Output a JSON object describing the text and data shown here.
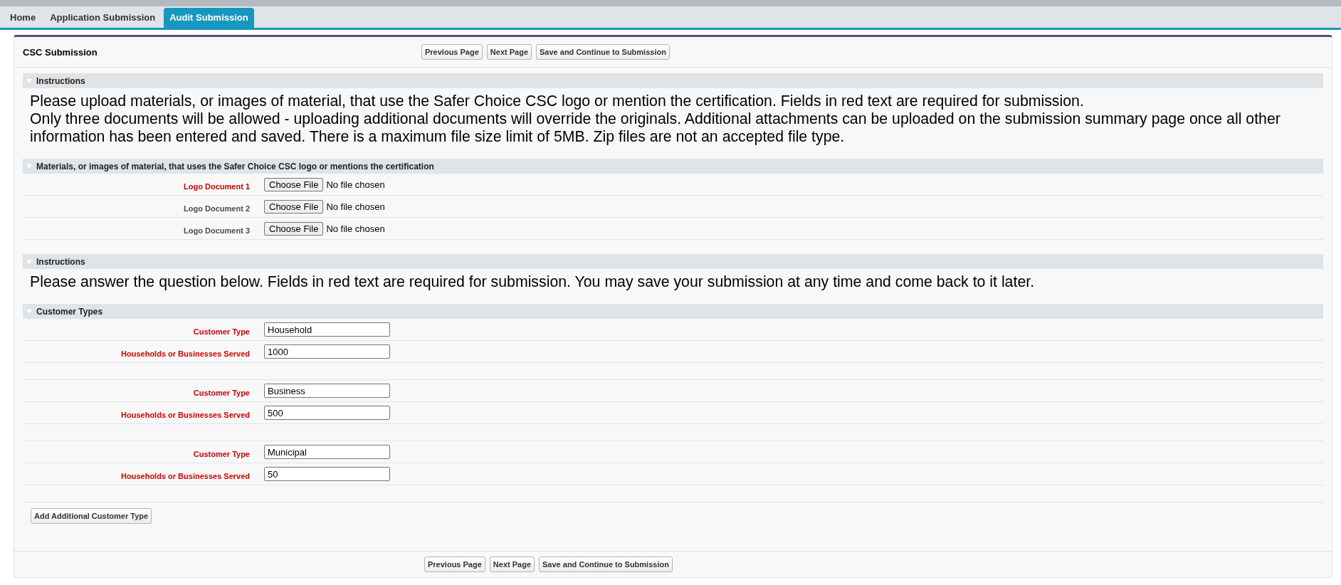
{
  "tabs": [
    {
      "label": "Home",
      "selected": false
    },
    {
      "label": "Application Submission",
      "selected": false
    },
    {
      "label": "Audit Submission",
      "selected": true
    }
  ],
  "header": {
    "title": "CSC Submission",
    "buttons": [
      "Previous Page",
      "Next Page",
      "Save and Continue to Submission"
    ]
  },
  "sections": [
    {
      "kind": "text",
      "title": "Instructions",
      "paragraphs": [
        "Please upload materials, or images of material, that use the Safer Choice CSC logo or mention the certification. Fields in red text are required for submission.",
        "Only three documents will be allowed - uploading additional documents will override the originals. Additional attachments can be uploaded on the submission summary page once all other information has been entered and saved. There is a maximum file size limit of 5MB. Zip files are not an accepted file type."
      ]
    },
    {
      "kind": "files",
      "title": "Materials, or images of material, that uses the Safer Choice CSC logo or mentions the certification",
      "fields": [
        {
          "label": "Logo Document 1",
          "required": true,
          "button": "Choose File",
          "status": "No file chosen"
        },
        {
          "label": "Logo Document 2",
          "required": false,
          "button": "Choose File",
          "status": "No file chosen"
        },
        {
          "label": "Logo Document 3",
          "required": false,
          "button": "Choose File",
          "status": "No file chosen"
        }
      ]
    },
    {
      "kind": "text",
      "title": "Instructions",
      "paragraphs": [
        "Please answer the question below. Fields in red text are required for submission. You may save your submission at any time and come back to it later."
      ]
    },
    {
      "kind": "customers",
      "title": "Customer Types",
      "groups": [
        {
          "fields": [
            {
              "label": "Customer Type",
              "required": true,
              "value": "Household"
            },
            {
              "label": "Households or Businesses Served",
              "required": true,
              "value": "1000"
            }
          ]
        },
        {
          "fields": [
            {
              "label": "Customer Type",
              "required": true,
              "value": "Business"
            },
            {
              "label": "Households or Businesses Served",
              "required": true,
              "value": "500"
            }
          ]
        },
        {
          "fields": [
            {
              "label": "Customer Type",
              "required": true,
              "value": "Municipal"
            },
            {
              "label": "Households or Businesses Served",
              "required": true,
              "value": "50"
            }
          ]
        }
      ],
      "add_button": "Add Additional Customer Type"
    }
  ],
  "footer": {
    "buttons": [
      "Previous Page",
      "Next Page",
      "Save and Continue to Submission"
    ]
  }
}
